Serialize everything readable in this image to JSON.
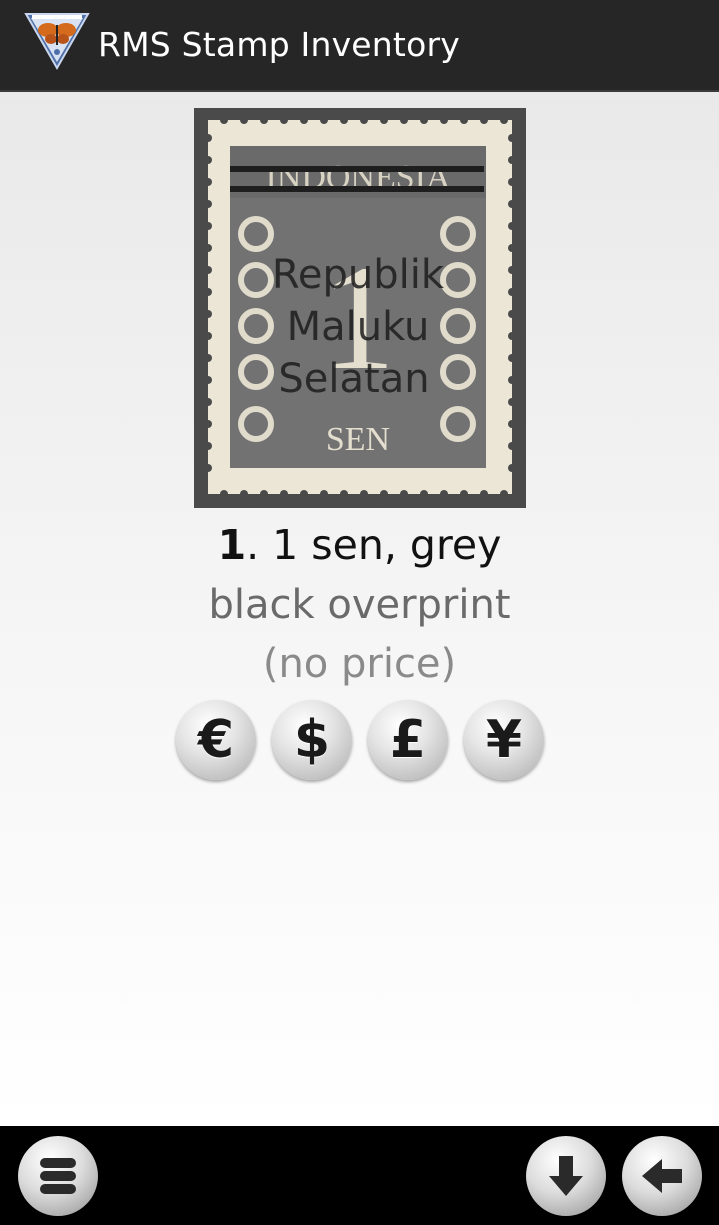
{
  "app": {
    "title": "RMS Stamp Inventory",
    "icon": "butterfly-logo-icon"
  },
  "stamp": {
    "image": "stamp-image",
    "original_text": "INDONESIA",
    "overprint_lines": [
      "Republik",
      "Maluku",
      "Selatan"
    ],
    "value_numeral": "1",
    "value_unit": "SEN"
  },
  "item": {
    "number": "1",
    "title_rest": ". 1 sen, grey",
    "subtitle": "black overprint",
    "price": "(no price)"
  },
  "currencies": [
    {
      "symbol": "€",
      "icon": "euro-icon"
    },
    {
      "symbol": "$",
      "icon": "dollar-icon"
    },
    {
      "symbol": "£",
      "icon": "pound-icon"
    },
    {
      "symbol": "¥",
      "icon": "yen-icon"
    }
  ],
  "bottom_bar": {
    "menu_icon": "menu-stack-icon",
    "download_icon": "arrow-down-icon",
    "back_icon": "arrow-left-icon"
  },
  "colors": {
    "action_bar": "#262626",
    "bottom_bar": "#000000",
    "stamp_grey": "#6e6e6e",
    "stamp_cream": "#efe9d9"
  }
}
